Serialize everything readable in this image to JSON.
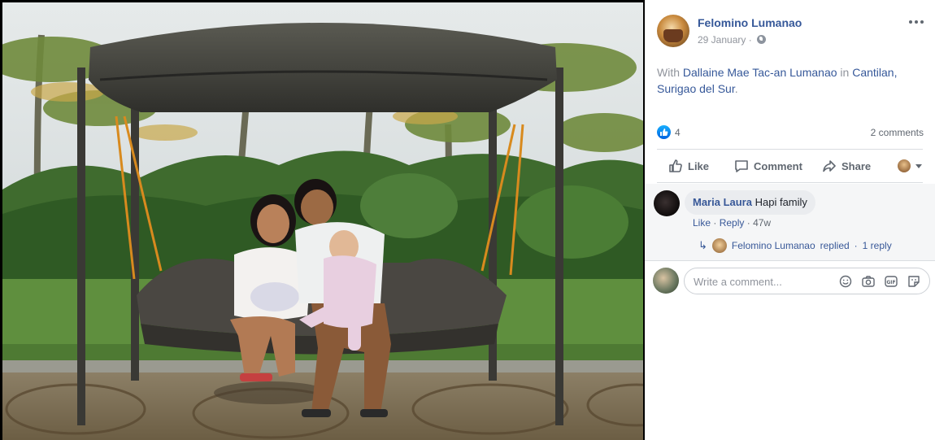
{
  "post": {
    "author": "Felomino Lumanao",
    "date": "29 January",
    "caption": {
      "prefix": "With ",
      "tagged_person": "Dallaine Mae Tac-an Lumanao",
      "middle": " in ",
      "location": "Cantilan, Surigao del Sur",
      "suffix": "."
    },
    "privacy_icon": "globe-icon",
    "menu_icon": "more-options-icon"
  },
  "reactions": {
    "count": "4",
    "icon": "like-reaction-icon",
    "comments_count": "2 comments"
  },
  "actions": {
    "like": "Like",
    "comment": "Comment",
    "share": "Share"
  },
  "comments": [
    {
      "name": "Maria Laura",
      "text": "Hapi family",
      "like": "Like",
      "reply": "Reply",
      "time": "47w",
      "reply_summary": {
        "name": "Felomino Lumanao",
        "text": "replied",
        "count": "1 reply"
      }
    }
  ],
  "composer": {
    "placeholder": "Write a comment...",
    "icons": [
      "emoji-icon",
      "camera-icon",
      "gif-icon",
      "sticker-icon"
    ]
  },
  "colors": {
    "link": "#365899",
    "muted": "#90949c",
    "like_blue": "#1877f2"
  }
}
